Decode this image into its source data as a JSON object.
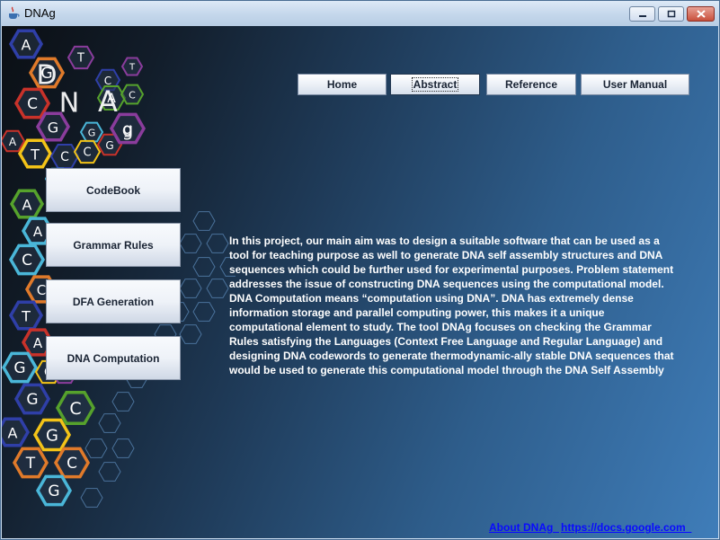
{
  "window": {
    "title": "DNAg"
  },
  "logo": {
    "text": "DNAg"
  },
  "nav": [
    {
      "id": "home",
      "label": "Home"
    },
    {
      "id": "abstract",
      "label": "Abstract"
    },
    {
      "id": "reference",
      "label": "Reference"
    },
    {
      "id": "user-manual",
      "label": "User Manual"
    }
  ],
  "side_menu": [
    {
      "id": "codebook",
      "label": "CodeBook"
    },
    {
      "id": "grammar-rules",
      "label": "Grammar Rules"
    },
    {
      "id": "dfa-generation",
      "label": "DFA Generation"
    },
    {
      "id": "dna-computation",
      "label": "DNA Computation"
    }
  ],
  "abstract": {
    "text": "In this project, our main aim was to design a suitable software that can be used as a tool for teaching purpose as well to generate DNA self assembly structures and DNA sequences which could be further used for experimental purposes. Problem statement addresses the issue of constructing DNA sequences using the computational model. DNA Computation means “computation using DNA”. DNA has extremely dense information storage and parallel computing power, this makes it a unique computational element to study. The tool DNAg focuses on checking the Grammar Rules satisfying the Languages (Context Free Language and Regular Language) and designing DNA codewords to generate thermodynamic-ally stable DNA sequences that would be used to generate this computational model through the DNA Self Assembly"
  },
  "footer": {
    "about_link": "About DNAg  ",
    "docs_link": "https://docs.google.com  "
  },
  "hex_letters": [
    "A",
    "G",
    "C",
    "G",
    "T",
    "C",
    "A",
    "A",
    "C",
    "C",
    "T",
    "A",
    "G",
    "G",
    "G",
    "C",
    "A",
    "G",
    "T",
    "C",
    "G",
    "T",
    "C",
    "A",
    "A",
    "G",
    "C",
    "C",
    "A",
    "G",
    "T",
    "A",
    "C",
    "g"
  ],
  "icons": {
    "app": "java-cup-icon",
    "minimize": "minimize-icon",
    "maximize": "maximize-icon",
    "close": "close-icon"
  },
  "colors": {
    "hex_blue": "#2f3fa8",
    "hex_red": "#c8322a",
    "hex_yellow": "#f3c318",
    "hex_green": "#56a22c",
    "hex_orange": "#e07a2a",
    "hex_cyan": "#4ab6d8",
    "hex_purple": "#8a3c9c",
    "link": "#0a0aff"
  }
}
